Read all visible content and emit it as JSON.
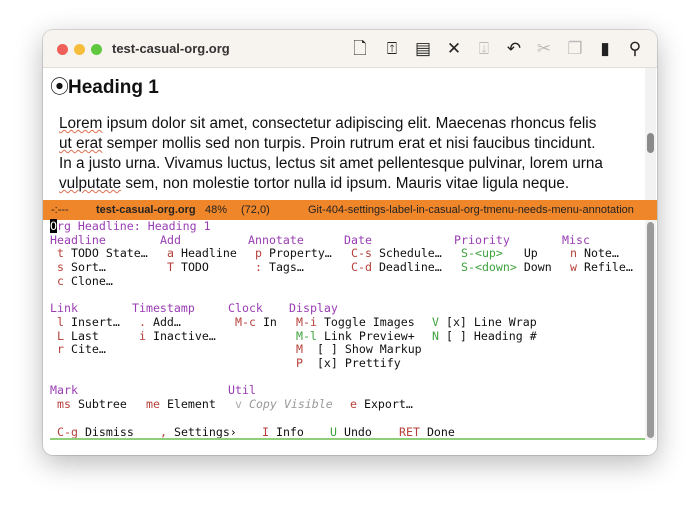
{
  "window": {
    "title": "test-casual-org.org",
    "traffic_lights": {
      "close": "#ee5f57",
      "minimize": "#f6bd3b",
      "zoom": "#5fc83f"
    }
  },
  "toolbar": {
    "icons": [
      "new-file-icon",
      "share-icon",
      "archive-icon",
      "close-icon",
      "download-icon",
      "undo-icon",
      "cut-icon",
      "copy-icon",
      "paste-icon",
      "search-icon"
    ]
  },
  "document": {
    "heading": "Heading 1",
    "lines": [
      [
        "Lorem",
        " ipsum dolor sit amet, consectetur adipiscing elit. Maecenas rhoncus felis"
      ],
      [
        "ut erat",
        " semper mollis sed non turpis. Proin rutrum erat et nisi faucibus tincidunt."
      ],
      [
        "",
        "In a justo urna. Vivamus luctus, lectus sit amet pellentesque pulvinar, lorem urna"
      ],
      [
        "vulputate",
        " sem, non molestie tortor nulla id ipsum. Mauris vitae ligula neque."
      ]
    ]
  },
  "modeline": {
    "status": "-:---",
    "buffer": "test-casual-org.org",
    "percent": "48%",
    "position": "(72,0)",
    "branch": "Git-404-settings-label-in-casual-org-tmenu-needs-menu-annotation",
    "color": "#f0862a"
  },
  "menu": {
    "title_cursor": "O",
    "title": "rg Headline: Heading 1",
    "headline": {
      "title": "Headline",
      "items": [
        {
          "key": "t",
          "label": "TODO State…"
        },
        {
          "key": "s",
          "label": "Sort…"
        },
        {
          "key": "c",
          "label": "Clone…"
        }
      ]
    },
    "add": {
      "title": "Add",
      "items": [
        {
          "key": "a",
          "label": "Headline"
        },
        {
          "key": "T",
          "label": "TODO"
        }
      ]
    },
    "annotate": {
      "title": "Annotate",
      "items": [
        {
          "key": "p",
          "label": "Property…"
        },
        {
          "key": ":",
          "label": "Tags…"
        }
      ]
    },
    "date": {
      "title": "Date",
      "items": [
        {
          "key": "C-s",
          "label": "Schedule…"
        },
        {
          "key": "C-d",
          "label": "Deadline…"
        }
      ]
    },
    "priority": {
      "title": "Priority",
      "items": [
        {
          "key": "S-<up>",
          "label": "Up"
        },
        {
          "key": "S-<down>",
          "label": "Down"
        }
      ]
    },
    "misc": {
      "title": "Misc",
      "items": [
        {
          "key": "n",
          "label": "Note…"
        },
        {
          "key": "w",
          "label": "Refile…"
        }
      ]
    },
    "link": {
      "title": "Link",
      "items": [
        {
          "key": "l",
          "label": "Insert…"
        },
        {
          "key": "L",
          "label": "Last"
        },
        {
          "key": "r",
          "label": "Cite…"
        }
      ]
    },
    "timestamp": {
      "title": "Timestamp",
      "items": [
        {
          "key": ".",
          "label": "Add…"
        },
        {
          "key": "i",
          "label": "Inactive…"
        }
      ]
    },
    "clock": {
      "title": "Clock",
      "items": [
        {
          "key": "M-c",
          "label": "In"
        }
      ]
    },
    "display": {
      "title": "Display",
      "items": [
        {
          "key": "M-i",
          "label": "Toggle Images"
        },
        {
          "key": "M-l",
          "label": "Link Preview+"
        },
        {
          "key": "M",
          "label": "[ ] Show Markup"
        },
        {
          "key": "P",
          "label": "[x] Prettify"
        },
        {
          "key": "V",
          "label": "[x] Line Wrap"
        },
        {
          "key": "N",
          "label": "[ ] Heading #"
        }
      ]
    },
    "mark": {
      "title": "Mark",
      "items": [
        {
          "key": "ms",
          "label": "Subtree"
        },
        {
          "key": "me",
          "label": "Element"
        }
      ]
    },
    "util": {
      "title": "Util",
      "items": [
        {
          "key": "v",
          "label": "Copy Visible",
          "disabled": true
        },
        {
          "key": "e",
          "label": "Export…"
        }
      ]
    },
    "footer": [
      {
        "key": "C-g",
        "label": "Dismiss"
      },
      {
        "key": ",",
        "label": "Settings›"
      },
      {
        "key": "I",
        "label": "Info"
      },
      {
        "key": "U",
        "label": "Undo"
      },
      {
        "key": "RET",
        "label": "Done"
      }
    ]
  },
  "colors": {
    "heading": "#9a3db3",
    "key": "#b5403a",
    "key_green": "#3fa33e",
    "disabled": "#999999"
  }
}
